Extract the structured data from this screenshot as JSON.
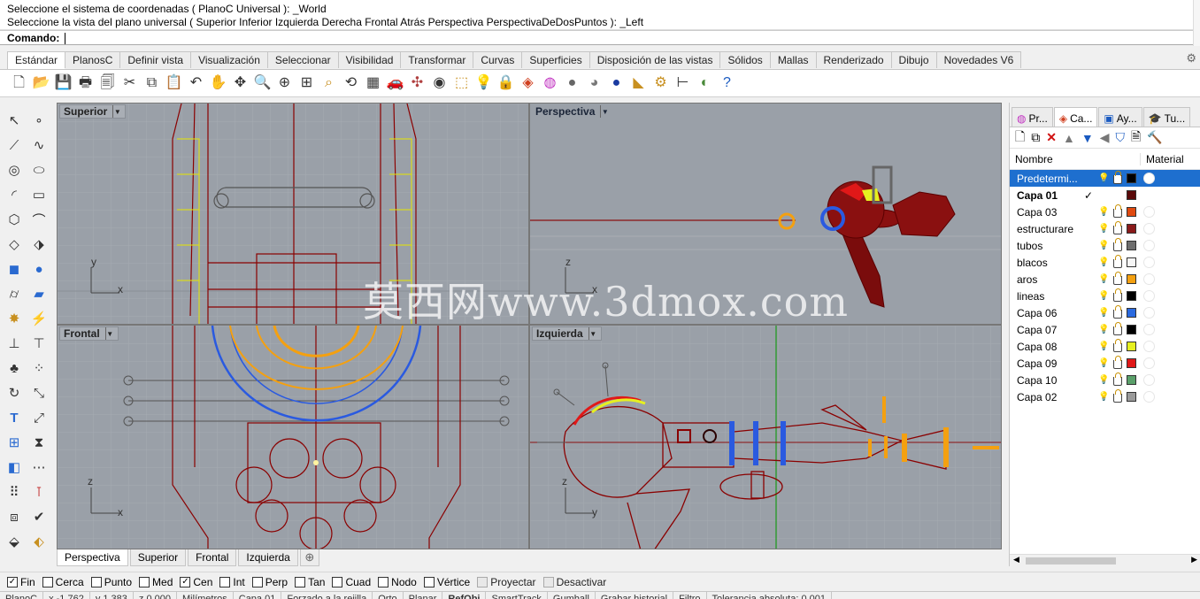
{
  "command": {
    "history_line1": "Seleccione el sistema de coordenadas ( PlanoC  Universal ): _World",
    "history_line2": "Seleccione la vista del plano universal ( Superior  Inferior  Izquierda  Derecha  Frontal  Atrás  Perspectiva  PerspectivaDeDosPuntos ): _Left",
    "prompt_label": "Comando:",
    "input_value": ""
  },
  "tabs": [
    "Estándar",
    "PlanosC",
    "Definir vista",
    "Visualización",
    "Seleccionar",
    "Visibilidad",
    "Transformar",
    "Curvas",
    "Superficies",
    "Disposición de las vistas",
    "Sólidos",
    "Mallas",
    "Renderizado",
    "Dibujo",
    "Novedades V6"
  ],
  "active_tab": "Estándar",
  "viewports": {
    "top": {
      "title": "Superior",
      "axis_x": "x",
      "axis_y": "y"
    },
    "perspective": {
      "title": "Perspectiva",
      "axis_x": "x",
      "axis_y": "z"
    },
    "front": {
      "title": "Frontal",
      "axis_x": "x",
      "axis_y": "z"
    },
    "left": {
      "title": "Izquierda",
      "axis_x": "y",
      "axis_y": "z"
    }
  },
  "viewport_tabs": [
    "Perspectiva",
    "Superior",
    "Frontal",
    "Izquierda"
  ],
  "watermark": "莫西网www.3dmox.com",
  "panel": {
    "tabs": [
      "Pr...",
      "Ca...",
      "Ay...",
      "Tu..."
    ],
    "col_name": "Nombre",
    "col_material": "Material",
    "layers": [
      {
        "name": "Predetermi...",
        "color": "#000000",
        "selected": true,
        "current": false
      },
      {
        "name": "Capa 01",
        "color": "#5a0a0a",
        "selected": false,
        "current": true
      },
      {
        "name": "Capa 03",
        "color": "#e04a10",
        "selected": false,
        "current": false
      },
      {
        "name": "estructurare",
        "color": "#8a1a1a",
        "selected": false,
        "current": false
      },
      {
        "name": "tubos",
        "color": "#6e6e6e",
        "selected": false,
        "current": false
      },
      {
        "name": "blacos",
        "color": "#f6f6f6",
        "selected": false,
        "current": false
      },
      {
        "name": "aros",
        "color": "#f4a010",
        "selected": false,
        "current": false
      },
      {
        "name": "lineas",
        "color": "#000000",
        "selected": false,
        "current": false
      },
      {
        "name": "Capa 06",
        "color": "#2a6ae0",
        "selected": false,
        "current": false
      },
      {
        "name": "Capa 07",
        "color": "#000000",
        "selected": false,
        "current": false
      },
      {
        "name": "Capa 08",
        "color": "#e6f020",
        "selected": false,
        "current": false
      },
      {
        "name": "Capa 09",
        "color": "#e01818",
        "selected": false,
        "current": false
      },
      {
        "name": "Capa 10",
        "color": "#5aa06a",
        "selected": false,
        "current": false
      },
      {
        "name": "Capa 02",
        "color": "#9a9a9a",
        "selected": false,
        "current": false
      }
    ]
  },
  "osnaps": [
    {
      "label": "Fin",
      "checked": true,
      "enabled": true
    },
    {
      "label": "Cerca",
      "checked": false,
      "enabled": true
    },
    {
      "label": "Punto",
      "checked": false,
      "enabled": true
    },
    {
      "label": "Med",
      "checked": false,
      "enabled": true
    },
    {
      "label": "Cen",
      "checked": true,
      "enabled": true
    },
    {
      "label": "Int",
      "checked": false,
      "enabled": true
    },
    {
      "label": "Perp",
      "checked": false,
      "enabled": true
    },
    {
      "label": "Tan",
      "checked": false,
      "enabled": true
    },
    {
      "label": "Cuad",
      "checked": false,
      "enabled": true
    },
    {
      "label": "Nodo",
      "checked": false,
      "enabled": true
    },
    {
      "label": "Vértice",
      "checked": false,
      "enabled": true
    },
    {
      "label": "Proyectar",
      "checked": false,
      "enabled": false
    },
    {
      "label": "Desactivar",
      "checked": false,
      "enabled": false
    }
  ],
  "status": {
    "plane": "PlanoC",
    "x": "x -1.762",
    "y": "y 1.383",
    "z": "z 0.000",
    "units": "Milímetros",
    "layer": "Capa 01",
    "snap": "Forzado a la rejilla",
    "orto": "Orto",
    "planar": "Planar",
    "osnap": "RefObj",
    "smarttrack": "SmartTrack",
    "gumball": "Gumball",
    "history": "Grabar historial",
    "filter": "Filtro",
    "tolerance": "Tolerancia absoluta: 0.001"
  }
}
